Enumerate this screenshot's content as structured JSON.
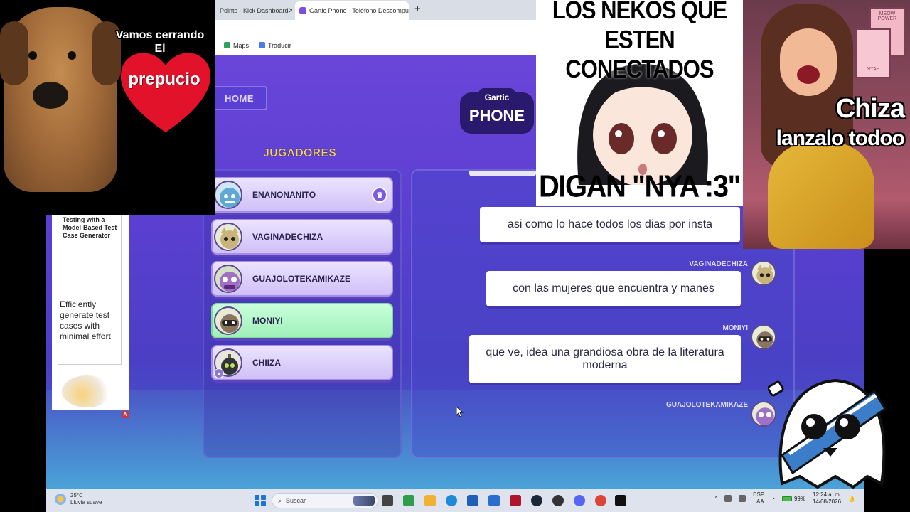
{
  "browser": {
    "tabs": [
      {
        "label": "Points - Kick Dashboard",
        "active": false
      },
      {
        "label": "Gartic Phone - Teléfono Descompu",
        "active": true
      }
    ],
    "bookmarks": [
      {
        "label": "Maps",
        "color": "#2ca35a"
      },
      {
        "label": "Traducir",
        "color": "#4a7be8"
      }
    ]
  },
  "game": {
    "home_label": "HOME",
    "logo_top": "Gartic",
    "logo_main": "PHONE",
    "players_title": "JUGADORES",
    "players": [
      {
        "name": "ENANONANITO",
        "host": true,
        "highlight": false,
        "avatar": "blue-yeti-avatar"
      },
      {
        "name": "VAGINADECHIZA",
        "host": false,
        "highlight": false,
        "avatar": "cat-avatar"
      },
      {
        "name": "GUAJOLOTEKAMIKAZE",
        "host": false,
        "highlight": false,
        "avatar": "purple-monster-avatar"
      },
      {
        "name": "MONIYI",
        "host": false,
        "highlight": true,
        "avatar": "raccoon-avatar"
      },
      {
        "name": "CHIIZA",
        "host": false,
        "highlight": false,
        "avatar": "bomb-avatar"
      }
    ],
    "chat": [
      {
        "author": "",
        "text": "asi como lo hace todos los dias por insta"
      },
      {
        "author": "VAGINADECHIZA",
        "text": "con las mujeres que encuentra y manes"
      },
      {
        "author": "MONIYI",
        "text": "que ve, idea una grandiosa obra de la literatura moderna"
      },
      {
        "author": "GUAJOLOTEKAMIKAZE",
        "text": ""
      }
    ]
  },
  "study_card": {
    "title": "Testing with a Model-Based Test Case Generator",
    "body": "Efficiently generate test cases with minimal effort",
    "badge": "A"
  },
  "overlays": {
    "dog_caption_line1": "Vamos cerrando",
    "dog_caption_line2": "El",
    "heart_text": "prepucio",
    "neko_top": "LOS NEKOS QUE ESTEN CONECTADOS",
    "neko_bottom": "DIGAN \"NYA :3\"",
    "cat_text_line1": "Chiza",
    "cat_text_line2": "lanzalo todoo",
    "poster_text_1": "MEOW POWER",
    "poster_text_2": "NYA~"
  },
  "taskbar": {
    "weather_temp": "25°C",
    "weather_desc": "Lluvia suave",
    "search_placeholder": "Buscar",
    "lang_1": "ESP",
    "lang_2": "LAA",
    "battery": "99%",
    "time": "12:24 a. m.",
    "date": "14/08/2026"
  }
}
